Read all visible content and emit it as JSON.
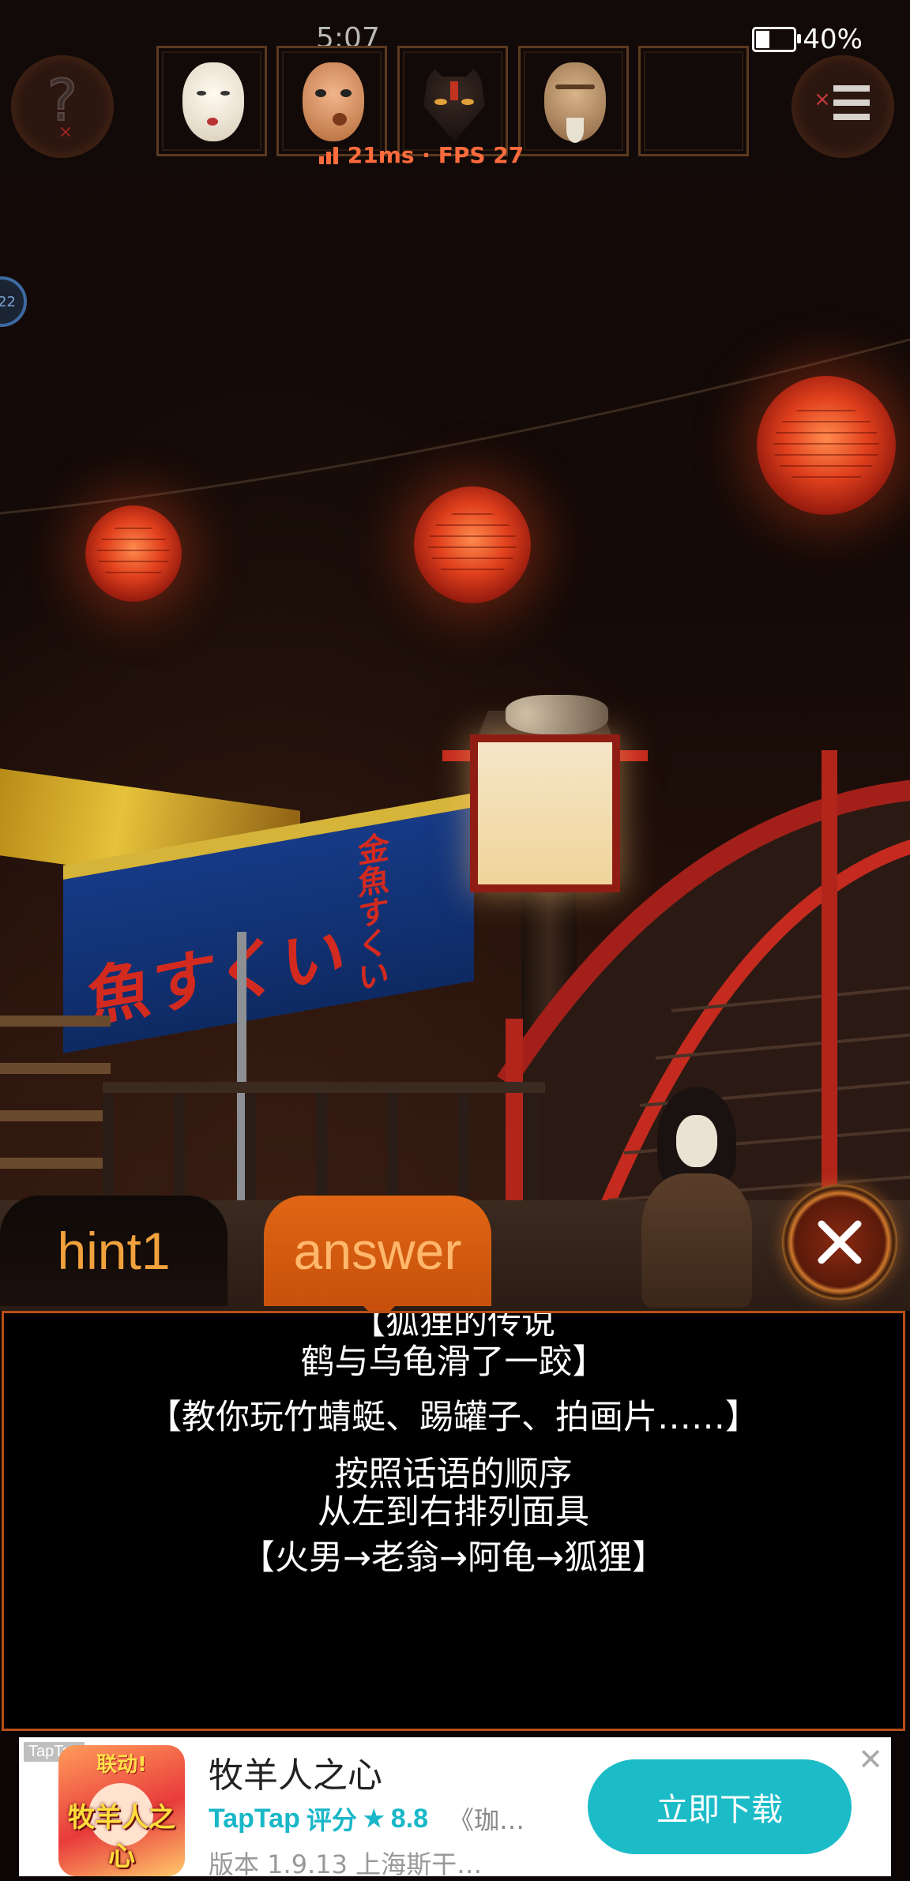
{
  "status_bar": {
    "time": "5:07",
    "battery_percent": "40%",
    "battery_level": 0.4
  },
  "perf_overlay": {
    "text": "21ms · FPS 27"
  },
  "side_badge": {
    "text": "22"
  },
  "top_bar": {
    "hint_icon": "question-mark-icon",
    "menu_icon": "menu-list-icon",
    "mask_slots": [
      {
        "mask": "okame-white-mask"
      },
      {
        "mask": "hyottoko-mask"
      },
      {
        "mask": "fox-mask"
      },
      {
        "mask": "old-man-mask"
      },
      {
        "mask": "empty"
      }
    ]
  },
  "scene": {
    "banner_left_text": "魚すくい",
    "banner_right_text": "金魚すくい"
  },
  "tabs": {
    "hint1_label": "hint1",
    "answer_label": "answer",
    "active": "answer"
  },
  "answer_panel": {
    "lines": [
      "【狐狸的传说",
      "鹤与乌龟滑了一跤】",
      "【教你玩竹蜻蜓、踢罐子、拍画片……】",
      "按照话语的顺序",
      "从左到右排列面具",
      "【火男→老翁→阿龟→狐狸】"
    ]
  },
  "ad": {
    "tag": "TapTap",
    "icon_badge": "联动!",
    "icon_text": "牧羊人之心",
    "title": "牧羊人之心",
    "rating_brand": "TapTap",
    "rating_label": "评分",
    "rating_value": "8.8",
    "description": "《珈…",
    "version": "版本 1.9.13   上海斯干…",
    "button_label": "立即下载"
  },
  "colors": {
    "accent_orange": "#c7510c",
    "hint_text": "#f1a23c",
    "ad_cyan": "#1bbcc8",
    "perf_text": "#ff6b3d"
  }
}
